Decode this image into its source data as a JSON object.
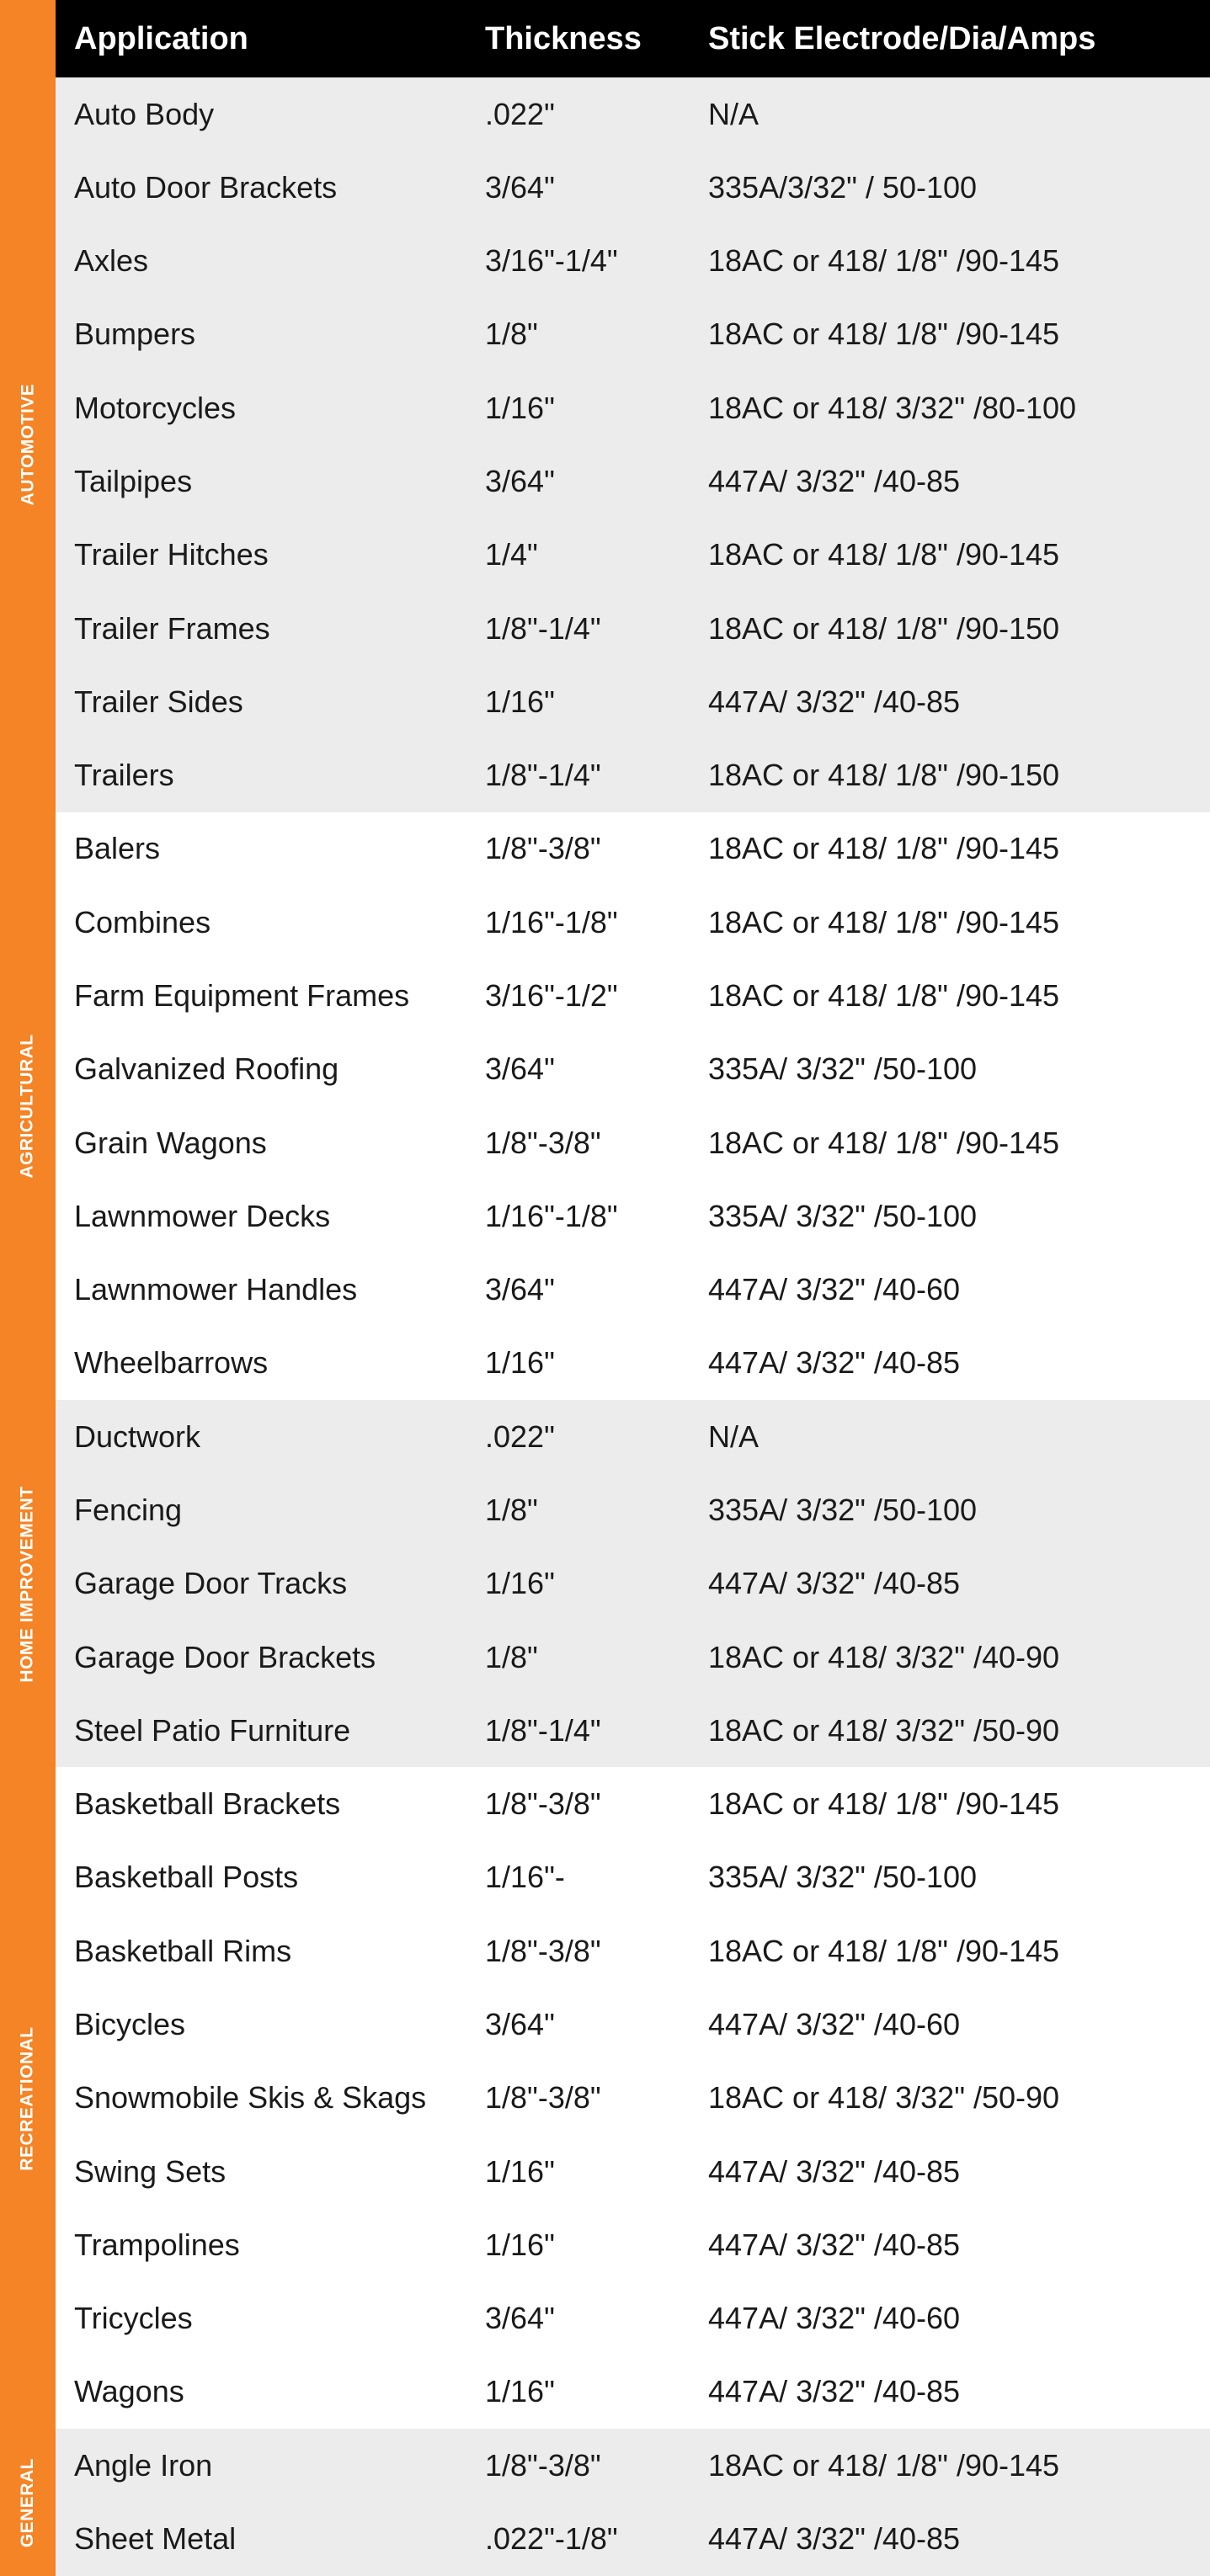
{
  "colors": {
    "accent_orange": "#f58426",
    "header_black": "#000000",
    "row_shaded": "#ececec",
    "row_plain": "#ffffff",
    "header_text": "#ffffff",
    "body_text": "#1a1a1a"
  },
  "table": {
    "headers": {
      "application": "Application",
      "thickness": "Thickness",
      "electrode": "Stick Electrode/Dia/Amps"
    },
    "sections": [
      {
        "label": "AUTOMOTIVE",
        "shaded": true,
        "rows": [
          {
            "application": "Auto Body",
            "thickness": ".022\"",
            "electrode": "N/A"
          },
          {
            "application": "Auto Door Brackets",
            "thickness": "3/64\"",
            "electrode": "335A/3/32\" / 50-100"
          },
          {
            "application": "Axles",
            "thickness": "3/16\"-1/4\"",
            "electrode": "18AC or 418/ 1/8\" /90-145"
          },
          {
            "application": "Bumpers",
            "thickness": "1/8\"",
            "electrode": "18AC or 418/ 1/8\" /90-145"
          },
          {
            "application": "Motorcycles",
            "thickness": "1/16\"",
            "electrode": "18AC or 418/ 3/32\" /80-100"
          },
          {
            "application": "Tailpipes",
            "thickness": "3/64\"",
            "electrode": "447A/ 3/32\" /40-85"
          },
          {
            "application": "Trailer Hitches",
            "thickness": "1/4\"",
            "electrode": "18AC or 418/ 1/8\" /90-145"
          },
          {
            "application": "Trailer Frames",
            "thickness": "1/8\"-1/4\"",
            "electrode": "18AC or 418/ 1/8\" /90-150"
          },
          {
            "application": "Trailer Sides",
            "thickness": "1/16\"",
            "electrode": "447A/ 3/32\" /40-85"
          },
          {
            "application": "Trailers",
            "thickness": "1/8\"-1/4\"",
            "electrode": "18AC or 418/ 1/8\" /90-150"
          }
        ]
      },
      {
        "label": "AGRICULTURAL",
        "shaded": false,
        "rows": [
          {
            "application": "Balers",
            "thickness": "1/8\"-3/8\"",
            "electrode": "18AC or 418/ 1/8\" /90-145"
          },
          {
            "application": "Combines",
            "thickness": "1/16\"-1/8\"",
            "electrode": "18AC or 418/ 1/8\" /90-145"
          },
          {
            "application": "Farm Equipment Frames",
            "thickness": "3/16\"-1/2\"",
            "electrode": "18AC or 418/ 1/8\" /90-145"
          },
          {
            "application": "Galvanized Roofing",
            "thickness": "3/64\"",
            "electrode": "335A/ 3/32\" /50-100"
          },
          {
            "application": "Grain Wagons",
            "thickness": "1/8\"-3/8\"",
            "electrode": "18AC or 418/ 1/8\" /90-145"
          },
          {
            "application": "Lawnmower Decks",
            "thickness": "1/16\"-1/8\"",
            "electrode": "335A/ 3/32\" /50-100"
          },
          {
            "application": "Lawnmower Handles",
            "thickness": "3/64\"",
            "electrode": "447A/ 3/32\" /40-60"
          },
          {
            "application": "Wheelbarrows",
            "thickness": "1/16\"",
            "electrode": "447A/ 3/32\" /40-85"
          }
        ]
      },
      {
        "label": "HOME IMPROVEMENT",
        "shaded": true,
        "rows": [
          {
            "application": "Ductwork",
            "thickness": ".022\"",
            "electrode": "N/A"
          },
          {
            "application": "Fencing",
            "thickness": "1/8\"",
            "electrode": "335A/ 3/32\" /50-100"
          },
          {
            "application": "Garage Door Tracks",
            "thickness": "1/16\"",
            "electrode": "447A/ 3/32\" /40-85"
          },
          {
            "application": "Garage Door Brackets",
            "thickness": "1/8\"",
            "electrode": "18AC or 418/ 3/32\" /40-90"
          },
          {
            "application": "Steel Patio Furniture",
            "thickness": "1/8\"-1/4\"",
            "electrode": "18AC or 418/ 3/32\" /50-90"
          }
        ]
      },
      {
        "label": "RECREATIONAL",
        "shaded": false,
        "rows": [
          {
            "application": "Basketball Brackets",
            "thickness": "1/8\"-3/8\"",
            "electrode": "18AC or 418/ 1/8\" /90-145"
          },
          {
            "application": "Basketball Posts",
            "thickness": "1/16\"-",
            "electrode": "335A/ 3/32\" /50-100"
          },
          {
            "application": "Basketball Rims",
            "thickness": "1/8\"-3/8\"",
            "electrode": "18AC or 418/ 1/8\" /90-145"
          },
          {
            "application": "Bicycles",
            "thickness": "3/64\"",
            "electrode": "447A/ 3/32\" /40-60"
          },
          {
            "application": "Snowmobile Skis & Skags",
            "thickness": "1/8\"-3/8\"",
            "electrode": "18AC or 418/ 3/32\" /50-90"
          },
          {
            "application": "Swing Sets",
            "thickness": "1/16\"",
            "electrode": "447A/ 3/32\" /40-85"
          },
          {
            "application": "Trampolines",
            "thickness": "1/16\"",
            "electrode": "447A/ 3/32\" /40-85"
          },
          {
            "application": "Tricycles",
            "thickness": "3/64\"",
            "electrode": "447A/ 3/32\" /40-60"
          },
          {
            "application": "Wagons",
            "thickness": "1/16\"",
            "electrode": "447A/ 3/32\" /40-85"
          }
        ]
      },
      {
        "label": "GENERAL",
        "shaded": true,
        "rows": [
          {
            "application": "Angle Iron",
            "thickness": "1/8\"-3/8\"",
            "electrode": "18AC or 418/ 1/8\" /90-145"
          },
          {
            "application": "Sheet Metal",
            "thickness": ".022\"-1/8\"",
            "electrode": "447A/ 3/32\" /40-85"
          }
        ]
      }
    ]
  }
}
